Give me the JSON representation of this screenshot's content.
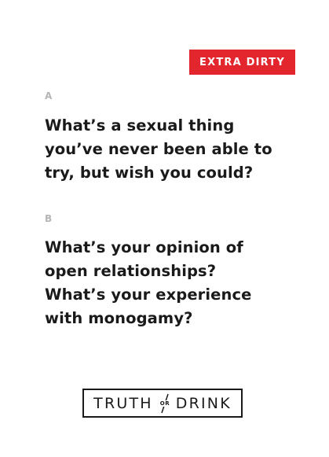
{
  "badge": {
    "label": "EXTRA DIRTY",
    "color": "#e3262d"
  },
  "questions": [
    {
      "letter": "A",
      "lines": [
        "What’s a sexual thing",
        "you’ve never been able to",
        "try, but wish you could?"
      ]
    },
    {
      "letter": "B",
      "lines": [
        "What’s your opinion of",
        "open relationships?",
        "What’s your experience",
        "with monogamy?"
      ]
    }
  ],
  "logo": {
    "left": "TRUTH",
    "middle": "OR",
    "right": "DRINK"
  }
}
